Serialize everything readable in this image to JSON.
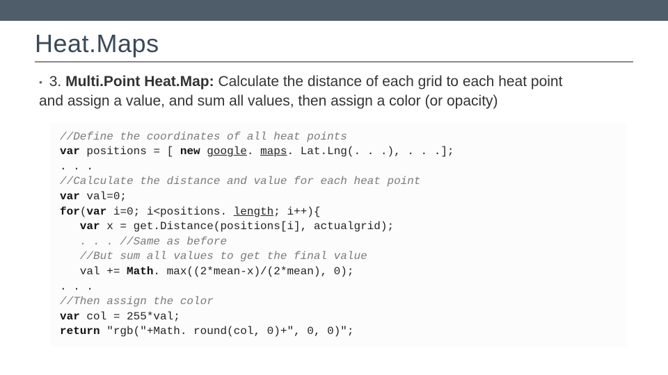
{
  "header": {
    "title": "Heat.Maps"
  },
  "bullet": {
    "lead_number": "3.",
    "lead_bold": "Multi.Point Heat.Map:",
    "desc1": " Calculate the distance of each grid to each heat point",
    "desc2": "and assign a value, and sum all values, then assign a color (or opacity)"
  },
  "code": {
    "l1": "//Define the coordinates of all heat points",
    "l2a": "var",
    "l2b": " positions = [ ",
    "l2c": "new",
    "l2d": " ",
    "l2e": "google",
    "l2f": ". ",
    "l2g": "maps",
    "l2h": ". Lat.Lng(. . .), . . .];",
    "l3": ". . .",
    "l4": "//Calculate the distance and value for each heat point",
    "l5a": "var",
    "l5b": " val=0;",
    "l6a": "for",
    "l6b": "(",
    "l6c": "var",
    "l6d": " i=0; i<positions. ",
    "l6e": "length",
    "l6f": "; i++){",
    "l7a": "   var",
    "l7b": " x = get.Distance(positions[i], actualgrid);",
    "l8": "   . . . //Same as before",
    "l9": "   //But sum all values to get the final value",
    "l10a": "   val += ",
    "l10b": "Math",
    "l10c": ". max((2*mean-x)/(2*mean), 0);",
    "l11": ". . .",
    "l12": "//Then assign the color",
    "l13a": "var",
    "l13b": " col = 255*val;",
    "l14a": "return",
    "l14b": " \"rgb(\"+Math. round(col, 0)+\", 0, 0)\";"
  }
}
